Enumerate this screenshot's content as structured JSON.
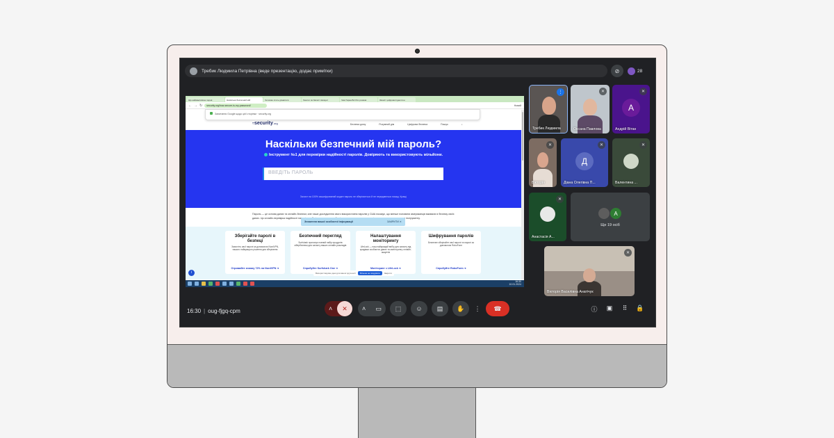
{
  "meet": {
    "presenter_label": "Требик Людмила Петрівна (веде презентацію, додає примітки)",
    "participant_count": "28",
    "time": "16:30",
    "meeting_code": "oug-fjgq-cpm"
  },
  "browser": {
    "tabs": [
      "Що найважливіше перев",
      "Наскільки безпечний мій",
      "Чи може хтось дізнатися",
      "Хештег як Захист Аккаунт",
      "Чим Гарна Всі Роз розмов",
      "Захист цифрової ідентичн"
    ],
    "url": "security.org/how-secure-is-my-password/",
    "url_right": "Новий",
    "suggestion": "Запитання Google щодо цієї сторінки",
    "suggestion_url": "security.org"
  },
  "site": {
    "logo": "security",
    "logo_suffix": ".org",
    "nav": [
      "Безпека дому",
      "Розумний дім",
      "Цифрова безпека",
      "Пошук"
    ],
    "hero_title": "Наскільки безпечний мій пароль?",
    "hero_subtitle": "Інструмент №1 для перевірки надійності паролів. Довіряють та використовують мільйони.",
    "password_placeholder": "ВВЕДІТЬ ПАРОЛЬ",
    "hero_note": "Захист на 100% зашифрований жоден пароль не зберігається й не передаються назад. Кращі",
    "body_text": "Пароль — це основа даних та онлайн-безпеки; але наше дослідження свого використання паролів у США показує, що менше половини американців вживали в безпеку своїх даних. Ця онлайн-перевірка надійності паролів, щоб дізнатися, вам знайомісну це стосувати, тож перевіримо за допомогою нашого інструменту.",
    "info_banner": {
      "text": "Зниження вашої особистої інформації",
      "action": "ЗАКРИТИ"
    },
    "cards": [
      {
        "title": "Зберігайте паролі в безпеці",
        "text": "Захистіть свої паролі за допомогою NordVPN, нашого найкращого рішення для зберігання",
        "link": "Отримайте знижку 72% на NordVPN ➔"
      },
      {
        "title": "Безпечний перегляд",
        "text": "Surfshark пропонує повний набір продуктів кібербезпеки для захисту ваших онлайн-розкладів",
        "link": "Спробуйте Surfshark One ➔"
      },
      {
        "title": "Налаштування моніторингу",
        "text": "LifeLock — наш найкращий вибір для захисту від крадіжки особистих даних та моніторингу онлайн-акаунтів",
        "link": "Моніторинг з LifeLock ➔"
      },
      {
        "title": "Шифрування паролів",
        "text": "Безпечне зберігайте свої паролі та паролі за допомогою RoboForm",
        "link": "Спробуйте RoboForm ➔"
      }
    ],
    "cookie_text": "Використовуємо дані для вашої зручності",
    "cookie_accept": "Більше не згадувати",
    "cookie_decline": "Закрити"
  },
  "taskbar": {
    "time": "16:30",
    "date": "10.01.2024"
  },
  "participants": [
    {
      "name": "Требик Людмила",
      "initial": "",
      "avatar_color": "",
      "state": "speaking"
    },
    {
      "name": "Оксана Павлова",
      "initial": "",
      "avatar_color": "",
      "state": "muted"
    },
    {
      "name": "Андрій Вітан",
      "initial": "А",
      "avatar_color": "#6a1b9a",
      "state": "muted"
    },
    {
      "name": "Вікторія",
      "initial": "",
      "avatar_color": "",
      "state": "muted"
    },
    {
      "name": "Діана Олегівна П...",
      "initial": "Д",
      "avatar_color": "#5c6bc0",
      "state": "muted"
    },
    {
      "name": "Валентина ...",
      "initial": "",
      "avatar_color": "",
      "state": "muted"
    },
    {
      "name": "Анастасія А...",
      "initial": "",
      "avatar_color": "",
      "state": "muted"
    },
    {
      "name": "Вікторія Василівна Анатічук",
      "initial": "",
      "avatar_color": "",
      "state": "muted"
    }
  ],
  "more_participants": {
    "label": "Ще 19 осіб",
    "initial": "А",
    "avatar_color": "#2e7d32"
  },
  "controls": [
    "raise-hand",
    "mic",
    "camera",
    "present",
    "emoji",
    "captions",
    "hand",
    "more",
    "end-call"
  ],
  "colors": {
    "hero_blue": "#2535f0",
    "end_call": "#d93025",
    "speaking": "#1a73e8"
  }
}
